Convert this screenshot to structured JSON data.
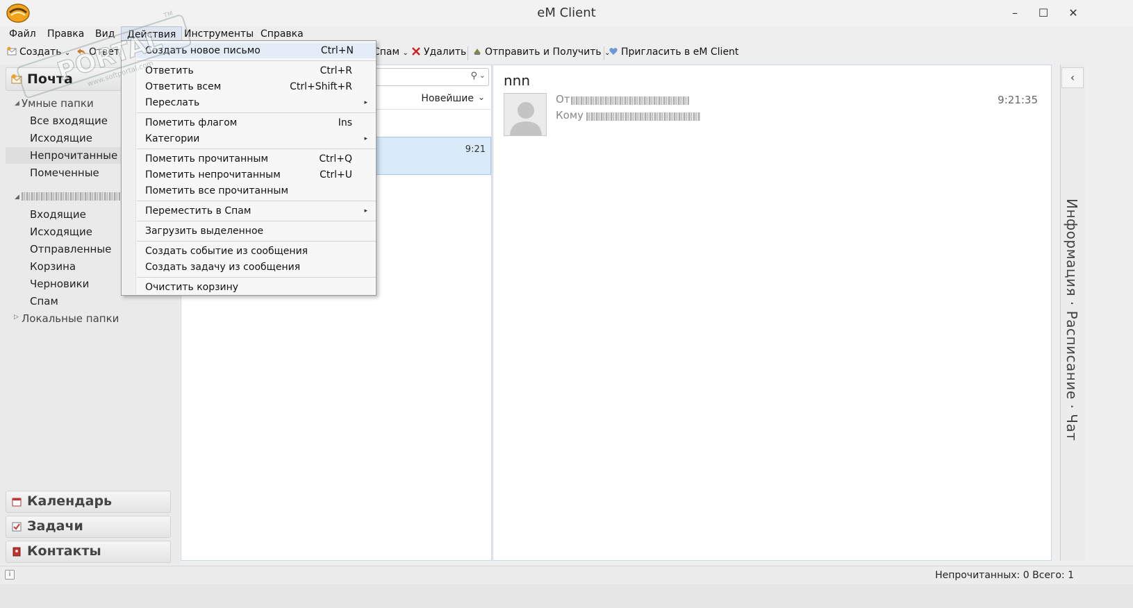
{
  "window": {
    "title": "eM Client",
    "minimize": "–",
    "maximize": "☐",
    "close": "✕"
  },
  "menubar": [
    {
      "label": "Файл"
    },
    {
      "label": "Правка"
    },
    {
      "label": "Вид"
    },
    {
      "label": "Действия"
    },
    {
      "label": "Инструменты"
    },
    {
      "label": "Справка"
    }
  ],
  "toolbar": {
    "create": "Создать",
    "reply": "Ответи",
    "spam": "Спам",
    "delete": "Удалить",
    "send_receive": "Отправить и Получить",
    "invite": "Пригласить в eM Client"
  },
  "sidebar": {
    "mail_title": "Почта",
    "smart_folders": "Умные папки",
    "smart_items": [
      "Все входящие",
      "Исходящие",
      "Непрочитанные",
      "Помеченные"
    ],
    "account_items": [
      "Входящие",
      "Исходящие",
      "Отправленные",
      "Корзина",
      "Черновики",
      "Спам"
    ],
    "local_folders": "Локальные папки",
    "nav": [
      "Календарь",
      "Задачи",
      "Контакты"
    ]
  },
  "list": {
    "sort_label": "Новейшие",
    "sort_chevron": "⌄",
    "message_time": "9:21"
  },
  "reading": {
    "subject": "nnn",
    "from_label": "От",
    "to_label": "Кому",
    "time": "9:21:35"
  },
  "right_bar": {
    "arrow": "‹",
    "text": "Информация · Расписание · Чат"
  },
  "status": {
    "text": "Непрочитанных: 0  Всего: 1",
    "info_icon": "i"
  },
  "dropdown": {
    "items": [
      {
        "label": "Создать новое письмо",
        "shortcut": "Ctrl+N"
      },
      {
        "label": "Ответить",
        "shortcut": "Ctrl+R"
      },
      {
        "label": "Ответить всем",
        "shortcut": "Ctrl+Shift+R"
      },
      {
        "label": "Переслать",
        "shortcut": "",
        "submenu": "▸"
      },
      {
        "label": "Пометить флагом",
        "shortcut": "Ins"
      },
      {
        "label": "Категории",
        "shortcut": "",
        "submenu": "▸"
      },
      {
        "label": "Пометить прочитанным",
        "shortcut": "Ctrl+Q"
      },
      {
        "label": "Пометить непрочитанным",
        "shortcut": "Ctrl+U"
      },
      {
        "label": "Пометить все прочитанным",
        "shortcut": ""
      },
      {
        "label": "Переместить в Спам",
        "shortcut": "",
        "submenu": "▸"
      },
      {
        "label": "Загрузить выделенное",
        "shortcut": ""
      },
      {
        "label": "Создать событие из сообщения",
        "shortcut": ""
      },
      {
        "label": "Создать задачу из сообщения",
        "shortcut": ""
      },
      {
        "label": "Очистить корзину",
        "shortcut": ""
      }
    ]
  },
  "watermark": {
    "brand": "PORTAL",
    "site": "www.softportal.com",
    "tm": "TM"
  },
  "colors": {
    "accent": "#f0a020",
    "selection": "#d9eaf9",
    "menu_highlight": "#e4ecf7"
  }
}
